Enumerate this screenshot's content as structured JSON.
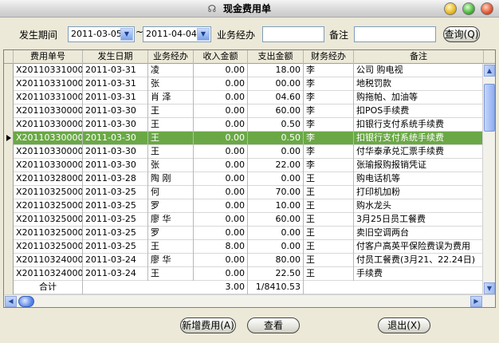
{
  "window": {
    "title": "现金费用单",
    "title_icon": "☊"
  },
  "filters": {
    "period_label": "发生期间",
    "date_from": "2011-03-05",
    "tilde": "~",
    "date_to": "2011-04-04",
    "handler_label": "业务经办",
    "handler_value": "",
    "remark_label": "备注",
    "remark_value": "",
    "query_button": "查询(Q)"
  },
  "table": {
    "columns": [
      "费用单号",
      "发生日期",
      "业务经办",
      "收入金额",
      "支出金额",
      "财务经办",
      "备注"
    ],
    "rows": [
      [
        "X201103310003",
        "2011-03-31",
        "凌",
        "0.00",
        "18.00",
        "李",
        "公司 购电视"
      ],
      [
        "X201103310002",
        "2011-03-31",
        "张",
        "0.00",
        "00.00",
        "李",
        "地税罚款"
      ],
      [
        "X201103310001",
        "2011-03-31",
        "肖 泽",
        "0.00",
        "04.60",
        "李",
        "购拖帕、加油等"
      ],
      [
        "X201103300005",
        "2011-03-30",
        "王",
        "0.00",
        "60.00",
        "李",
        "扣POS手续费"
      ],
      [
        "X201103300004",
        "2011-03-30",
        "王",
        "0.00",
        "0.50",
        "李",
        "扣银行支付系统手续费"
      ],
      [
        "X201103300003",
        "2011-03-30",
        "王",
        "0.00",
        "0.50",
        "李",
        "扣银行支付系统手续费"
      ],
      [
        "X201103300002",
        "2011-03-30",
        "王",
        "0.00",
        "0.00",
        "李",
        "付华泰承兑汇票手续费"
      ],
      [
        "X201103300001",
        "2011-03-30",
        "张",
        "0.00",
        "22.00",
        "李",
        "张瑜报购报销凭证"
      ],
      [
        "X201103280001",
        "2011-03-28",
        "陶 刚",
        "0.00",
        "0.00",
        "王",
        "购电话机等"
      ],
      [
        "X201103250005",
        "2011-03-25",
        "何",
        "0.00",
        "70.00",
        "王",
        "打印机加粉"
      ],
      [
        "X201103250004",
        "2011-03-25",
        "罗",
        "0.00",
        "10.00",
        "王",
        "购水龙头"
      ],
      [
        "X201103250003",
        "2011-03-25",
        "廖 华",
        "0.00",
        "60.00",
        "王",
        "3月25日员工餐费"
      ],
      [
        "X201103250002",
        "2011-03-25",
        "罗",
        "0.00",
        "0.00",
        "王",
        "卖旧空调两台"
      ],
      [
        "X201103250001",
        "2011-03-25",
        "王",
        "8.00",
        "0.00",
        "王",
        "付客户高英平保险费误为费用"
      ],
      [
        "X201103240005",
        "2011-03-24",
        "廖 华",
        "0.00",
        "80.00",
        "王",
        "付员工餐费(3月21、22.24日)"
      ],
      [
        "X201103240004",
        "2011-03-24",
        "王",
        "0.00",
        "22.50",
        "王",
        "手续费"
      ]
    ],
    "selected_row": 5,
    "total_label": "合计",
    "total_income": "3.00",
    "total_expense": "1/8410.53"
  },
  "actions": {
    "add_button": "新增费用(A)",
    "view_button": "查看",
    "exit_button": "退出(X)"
  },
  "colors": {
    "selected_row": "#6aa846",
    "window_bg": "#ece9d8"
  }
}
